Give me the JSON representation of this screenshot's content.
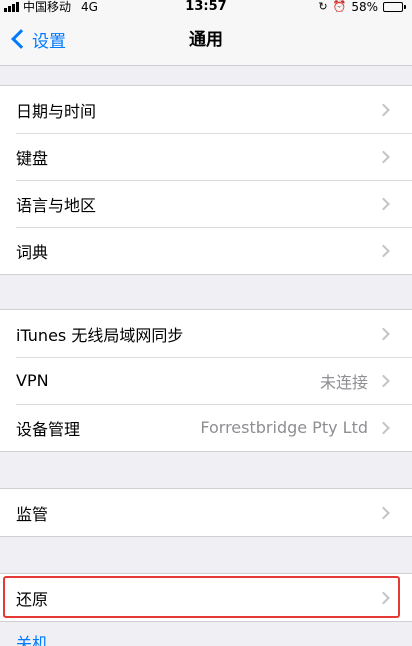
{
  "status_bar": {
    "carrier": "中国移动",
    "network": "4G",
    "time": "13:57",
    "battery_percent_label": "58%",
    "battery_level": 0.58,
    "icons": [
      "signal-icon",
      "rotation-lock-icon",
      "alarm-icon",
      "battery-icon"
    ]
  },
  "nav": {
    "back_label": "设置",
    "title": "通用"
  },
  "group1": {
    "items": [
      {
        "label": "日期与时间"
      },
      {
        "label": "键盘"
      },
      {
        "label": "语言与地区"
      },
      {
        "label": "词典"
      }
    ]
  },
  "group2": {
    "items": [
      {
        "label": "iTunes 无线局域网同步",
        "value": ""
      },
      {
        "label": "VPN",
        "value": "未连接"
      },
      {
        "label": "设备管理",
        "value": "Forrestbridge Pty Ltd"
      }
    ]
  },
  "group3": {
    "items": [
      {
        "label": "监管"
      }
    ]
  },
  "group4": {
    "items": [
      {
        "label": "还原"
      }
    ]
  },
  "shutdown": {
    "label": "关机"
  },
  "colors": {
    "accent": "#007aff",
    "background": "#efeff4",
    "highlight": "#e53935",
    "secondary_text": "#8e8e93"
  }
}
